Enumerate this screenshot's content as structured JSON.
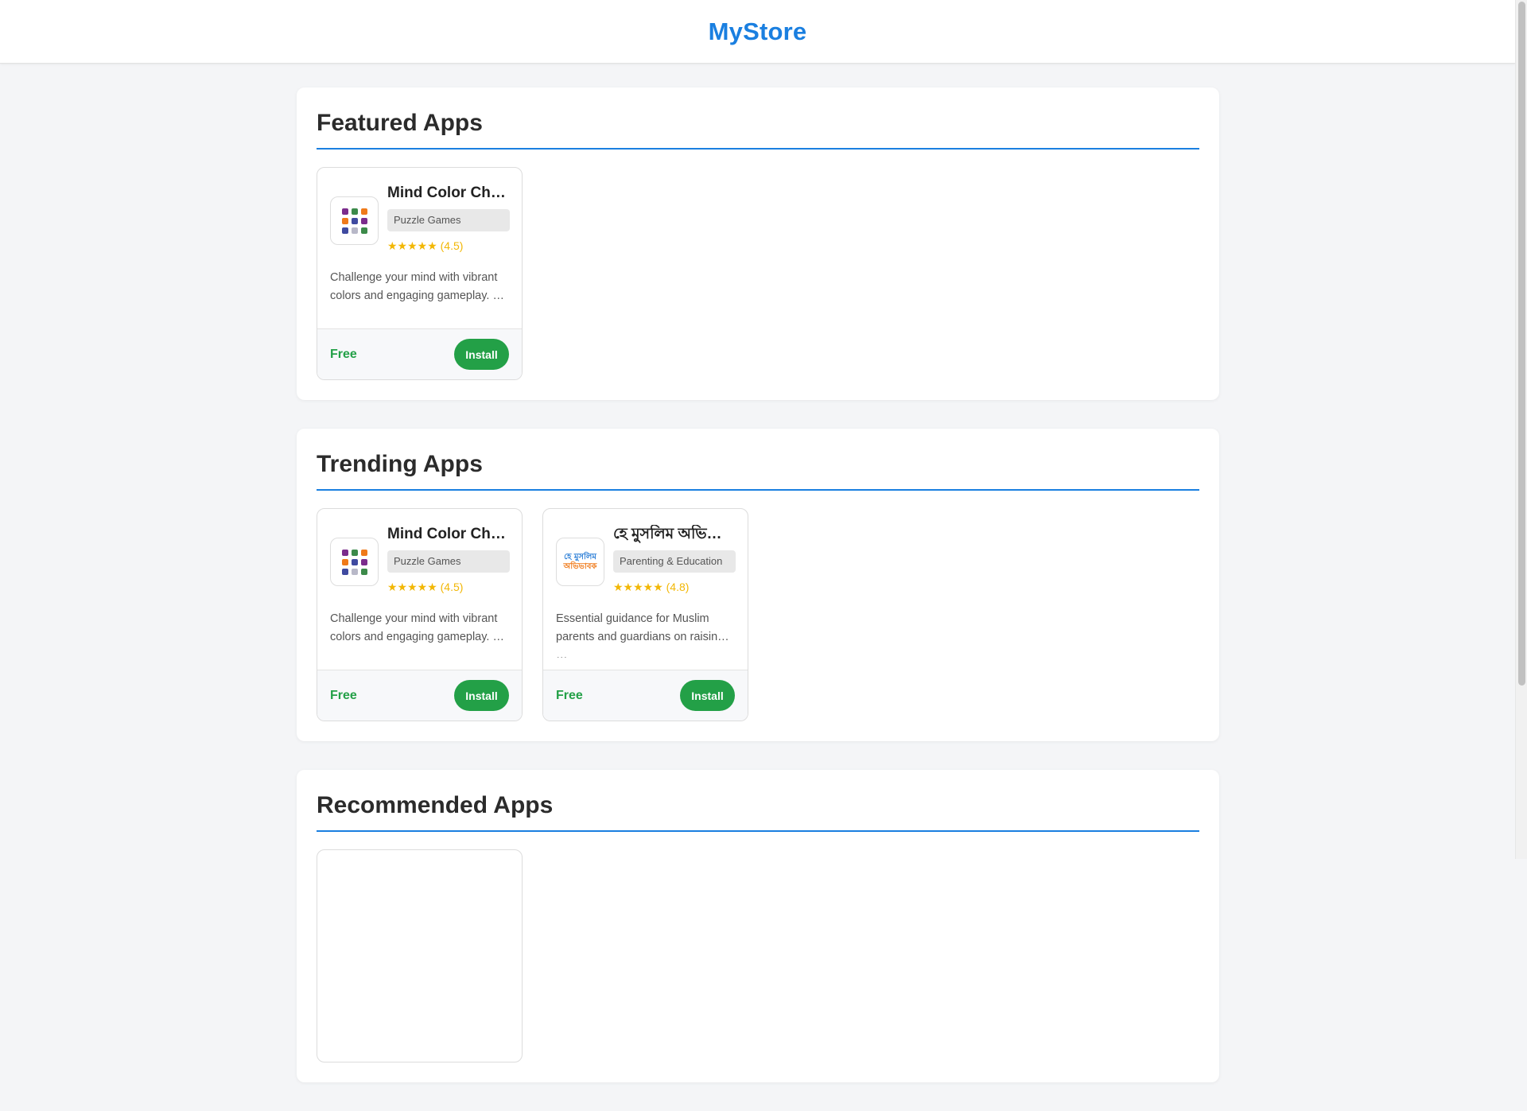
{
  "header": {
    "brand": "MyStore"
  },
  "colors": {
    "accent": "#1a7fe0",
    "install": "#23a047",
    "star": "#f2b705"
  },
  "sections": [
    {
      "title": "Featured Apps",
      "apps": [
        {
          "name": "Mind Color Chal…",
          "category": "Puzzle Games",
          "rating": "★★★★★ (4.5)",
          "description": "Challenge your mind with vibrant colors and engaging gameplay. …",
          "price": "Free",
          "install_label": "Install",
          "icon": "color-grid-icon"
        }
      ]
    },
    {
      "title": "Trending Apps",
      "apps": [
        {
          "name": "Mind Color Chal…",
          "category": "Puzzle Games",
          "rating": "★★★★★ (4.5)",
          "description": "Challenge your mind with vibrant colors and engaging gameplay. …",
          "price": "Free",
          "install_label": "Install",
          "icon": "color-grid-icon"
        },
        {
          "name": "হে মুসলিম অভিভা…",
          "category": "Parenting & Education",
          "rating": "★★★★★ (4.8)",
          "description": "Essential guidance for Muslim parents and guardians on raising …",
          "price": "Free",
          "install_label": "Install",
          "icon": "bengali-text-logo-icon",
          "icon_text": [
            "হে মুসলিম",
            "অভিভাবক"
          ]
        }
      ]
    },
    {
      "title": "Recommended Apps",
      "apps": []
    }
  ]
}
